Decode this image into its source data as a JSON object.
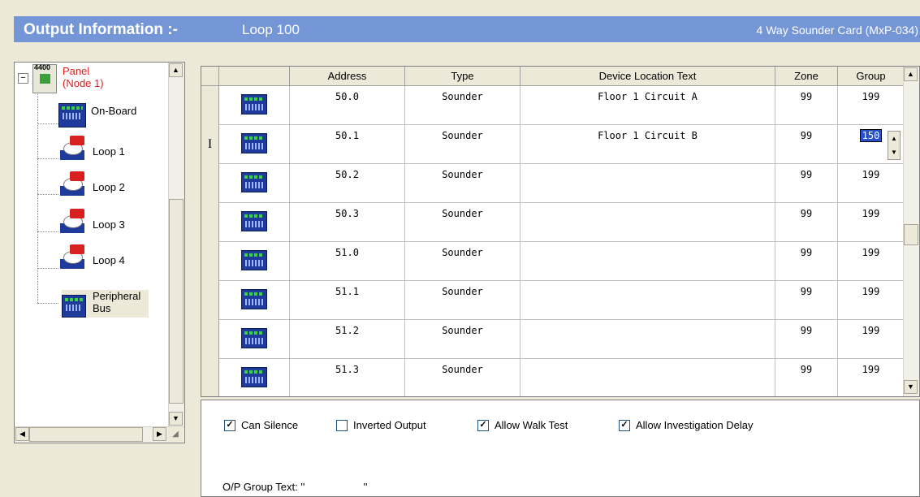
{
  "header": {
    "title": "Output Information :-",
    "loop": "Loop 100",
    "card": "4 Way Sounder Card (MxP-034)"
  },
  "tree": {
    "panel_badge": "4400",
    "panel_label_1": "Panel",
    "panel_label_2": "(Node 1)",
    "panel_label_color": "#d92020",
    "items": [
      {
        "label": "On-Board",
        "icon": "onboard-card-icon"
      },
      {
        "label": "Loop 1",
        "icon": "loop-device-icon"
      },
      {
        "label": "Loop 2",
        "icon": "loop-device-icon"
      },
      {
        "label": "Loop 3",
        "icon": "loop-device-icon"
      },
      {
        "label": "Loop 4",
        "icon": "loop-device-icon"
      },
      {
        "label": "Peripheral",
        "label2": "Bus",
        "icon": "peripheral-bus-icon"
      }
    ]
  },
  "grid": {
    "columns": [
      "Address",
      "Type",
      "Device Location Text",
      "Zone",
      "Group"
    ],
    "rows": [
      {
        "marker": "",
        "address": "50.0",
        "type": "Sounder",
        "location": "Floor 1 Circuit A",
        "zone": "99",
        "group": "199"
      },
      {
        "marker": "I",
        "address": "50.1",
        "type": "Sounder",
        "location": "Floor 1 Circuit B",
        "zone": "99",
        "group": "150"
      },
      {
        "marker": "",
        "address": "50.2",
        "type": "Sounder",
        "location": "",
        "zone": "99",
        "group": "199"
      },
      {
        "marker": "",
        "address": "50.3",
        "type": "Sounder",
        "location": "",
        "zone": "99",
        "group": "199"
      },
      {
        "marker": "",
        "address": "51.0",
        "type": "Sounder",
        "location": "",
        "zone": "99",
        "group": "199"
      },
      {
        "marker": "",
        "address": "51.1",
        "type": "Sounder",
        "location": "",
        "zone": "99",
        "group": "199"
      },
      {
        "marker": "",
        "address": "51.2",
        "type": "Sounder",
        "location": "",
        "zone": "99",
        "group": "199"
      },
      {
        "marker": "",
        "address": "51.3",
        "type": "Sounder",
        "location": "",
        "zone": "99",
        "group": "199"
      }
    ]
  },
  "options": {
    "can_silence": {
      "label": "Can Silence",
      "checked": true
    },
    "inverted_output": {
      "label": "Inverted Output",
      "checked": false
    },
    "allow_walk_test": {
      "label": "Allow Walk Test",
      "checked": true
    },
    "allow_investigation_delay": {
      "label": "Allow Investigation Delay",
      "checked": true
    },
    "group_text_label": "O/P Group Text:",
    "group_text_value": "''                    ''"
  },
  "colors": {
    "header_bg": "#7496d6",
    "selection": "#2850c8"
  }
}
